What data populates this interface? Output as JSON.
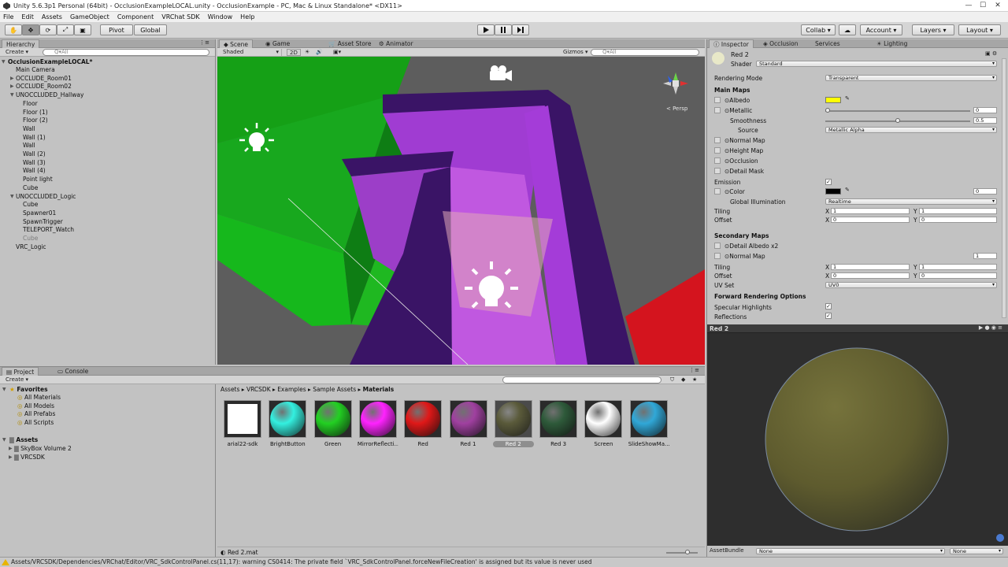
{
  "window": {
    "title": "Unity 5.6.3p1 Personal (64bit) - OcclusionExampleLOCAL.unity - OcclusionExample - PC, Mac & Linux Standalone* <DX11>"
  },
  "menu": [
    "File",
    "Edit",
    "Assets",
    "GameObject",
    "Component",
    "VRChat SDK",
    "Window",
    "Help"
  ],
  "toolbar": {
    "pivot": "Pivot",
    "global": "Global",
    "collab": "Collab ▾",
    "account": "Account",
    "layers": "Layers",
    "layout": "Layout"
  },
  "hierarchy": {
    "tab": "Hierarchy",
    "create": "Create",
    "search_placeholder": "Q▾All",
    "scene": "OcclusionExampleLOCAL*",
    "items": [
      {
        "label": "Main Camera",
        "depth": 1,
        "arrow": ""
      },
      {
        "label": "OCCLUDE_Room01",
        "depth": 1,
        "arrow": "▶"
      },
      {
        "label": "OCCLUDE_Room02",
        "depth": 1,
        "arrow": "▶"
      },
      {
        "label": "UNOCCLUDED_Hallway",
        "depth": 1,
        "arrow": "▼"
      },
      {
        "label": "Floor",
        "depth": 2,
        "arrow": ""
      },
      {
        "label": "Floor (1)",
        "depth": 2,
        "arrow": ""
      },
      {
        "label": "Floor (2)",
        "depth": 2,
        "arrow": ""
      },
      {
        "label": "Wall",
        "depth": 2,
        "arrow": ""
      },
      {
        "label": "Wall (1)",
        "depth": 2,
        "arrow": ""
      },
      {
        "label": "Wall",
        "depth": 2,
        "arrow": ""
      },
      {
        "label": "Wall (2)",
        "depth": 2,
        "arrow": ""
      },
      {
        "label": "Wall (3)",
        "depth": 2,
        "arrow": ""
      },
      {
        "label": "Wall (4)",
        "depth": 2,
        "arrow": ""
      },
      {
        "label": "Point light",
        "depth": 2,
        "arrow": ""
      },
      {
        "label": "Cube",
        "depth": 2,
        "arrow": ""
      },
      {
        "label": "UNOCCLUDED_Logic",
        "depth": 1,
        "arrow": "▼"
      },
      {
        "label": "Cube",
        "depth": 2,
        "arrow": ""
      },
      {
        "label": "Spawner01",
        "depth": 2,
        "arrow": ""
      },
      {
        "label": "SpawnTrigger",
        "depth": 2,
        "arrow": ""
      },
      {
        "label": "TELEPORT_Watch",
        "depth": 2,
        "arrow": ""
      },
      {
        "label": "Cube",
        "depth": 2,
        "arrow": "",
        "dim": true
      },
      {
        "label": "VRC_Logic",
        "depth": 1,
        "arrow": ""
      }
    ]
  },
  "scene_view": {
    "tabs": [
      "Scene",
      "Game",
      "Asset Store",
      "Animator"
    ],
    "shading": "Shaded",
    "mode_2d": "2D",
    "gizmos": "Gizmos",
    "search_placeholder": "Q▾All",
    "persp": "< Persp",
    "colors": {
      "sky": "#5d5d5d",
      "green": "#18a81e",
      "purple": "#a03cd2",
      "dark_purple": "#3a1466",
      "red": "#d4141e"
    }
  },
  "project": {
    "tabs": [
      "Project",
      "Console"
    ],
    "create": "Create",
    "favorites_label": "Favorites",
    "favorites": [
      "All Materials",
      "All Models",
      "All Prefabs",
      "All Scripts"
    ],
    "assets_label": "Assets",
    "assets": [
      "SkyBox Volume 2",
      "VRCSDK"
    ],
    "breadcrumb": [
      "Assets",
      "VRCSDK",
      "Examples",
      "Sample Assets",
      "Materials"
    ],
    "materials": [
      {
        "label": "arial22-sdk",
        "color": "#ffffff",
        "square": true
      },
      {
        "label": "BrightButton",
        "color": "#33f0e0"
      },
      {
        "label": "Green",
        "color": "#22d022"
      },
      {
        "label": "MirrorReflecti...",
        "color": "#ff22ff"
      },
      {
        "label": "Red",
        "color": "#e01818"
      },
      {
        "label": "Red 1",
        "color": "#a040a0"
      },
      {
        "label": "Red 2",
        "color": "#5a5a3a",
        "selected": true
      },
      {
        "label": "Red 3",
        "color": "#2e5a3a"
      },
      {
        "label": "Screen",
        "color": "#ffffff"
      },
      {
        "label": "SlideShowMa...",
        "color": "#30a8d8"
      }
    ],
    "selected_path": "Red 2.mat"
  },
  "inspector": {
    "tabs": [
      "Inspector",
      "Occlusion",
      "Services",
      "Lighting"
    ],
    "material_name": "Red 2",
    "shader_label": "Shader",
    "shader_value": "Standard",
    "rendering_mode_label": "Rendering Mode",
    "rendering_mode_value": "Transparent",
    "main_maps": "Main Maps",
    "albedo": "Albedo",
    "albedo_color": "#ffff00",
    "metallic": "Metallic",
    "metallic_value": "0",
    "metallic_level": 0,
    "smoothness": "Smoothness",
    "smoothness_value": "0.5",
    "smoothness_level": 0.5,
    "source_label": "Source",
    "source_value": "Metallic Alpha",
    "normal_map": "Normal Map",
    "height_map": "Height Map",
    "occlusion": "Occlusion",
    "detail_mask": "Detail Mask",
    "emission": "Emission",
    "color_label": "Color",
    "emission_value": "0",
    "global_illum_label": "Global Illumination",
    "global_illum_value": "Realtime",
    "tiling": "Tiling",
    "offset": "Offset",
    "tiling_x": "1",
    "tiling_y": "1",
    "offset_x": "0",
    "offset_y": "0",
    "secondary_maps": "Secondary Maps",
    "detail_albedo": "Detail Albedo x2",
    "sec_normal_map": "Normal Map",
    "sec_normal_value": "1",
    "sec_tiling_x": "1",
    "sec_tiling_y": "1",
    "sec_offset_x": "0",
    "sec_offset_y": "0",
    "uv_set_label": "UV Set",
    "uv_set_value": "UV0",
    "forward_options": "Forward Rendering Options",
    "specular_highlights": "Specular Highlights",
    "reflections": "Reflections",
    "x_label": "X",
    "y_label": "Y",
    "preview_title": "Red 2",
    "asset_bundle_label": "AssetBundle",
    "asset_bundle_value": "None",
    "asset_bundle_variant": "None"
  },
  "status": {
    "message": "Assets/VRCSDK/Dependencies/VRChat/Editor/VRC_SdkControlPanel.cs(11,17): warning CS0414: The private field `VRC_SdkControlPanel.forceNewFileCreation' is assigned but its value is never used"
  }
}
